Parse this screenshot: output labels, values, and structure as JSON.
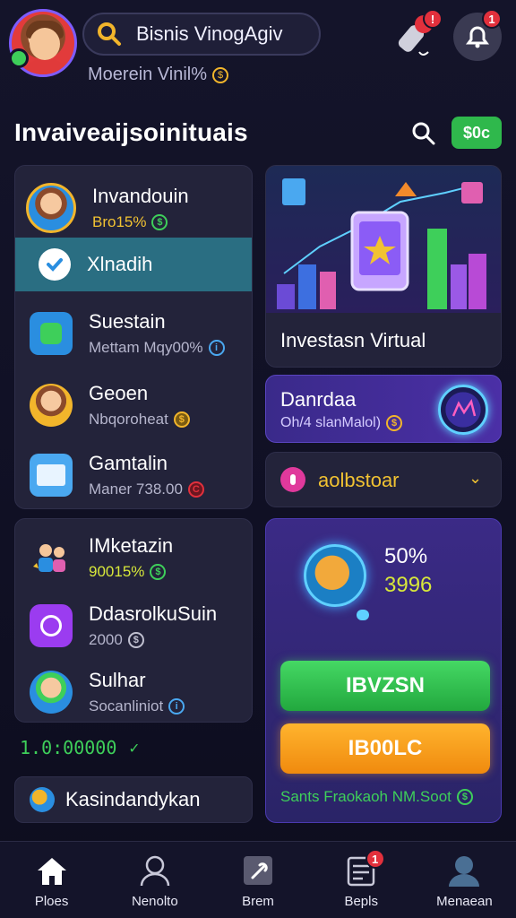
{
  "header": {
    "search_text": "Bisnis VinogAgiv",
    "subtitle": "Moerein Vinil%",
    "subtitle_coin": "$",
    "mic_badge": "!",
    "bell_badge": "1"
  },
  "section": {
    "title": "Invaiveaijsoinituais",
    "price_button": "$0c"
  },
  "list1": {
    "items": [
      {
        "title": "Invandouin",
        "sub": "Bro15%",
        "coin": "$"
      },
      {
        "title": "Xlnadih"
      },
      {
        "title": "Suestain",
        "sub": "Mettam Mqy00%",
        "coin": "i"
      },
      {
        "title": "Geoen",
        "sub": "Nbqoroheat",
        "coin": "$"
      },
      {
        "title": "Gamtalin",
        "sub": "Maner 738.00",
        "coin": "C"
      }
    ]
  },
  "hero": {
    "caption": "Investasn Virtual"
  },
  "promo": {
    "title": "Danrdaa",
    "sub": "Oh/4 slanMalol)",
    "coin": "$"
  },
  "dropdown": {
    "label": "aolbstoar",
    "chevron": "⌄"
  },
  "list2": {
    "items": [
      {
        "title": "IMketazin",
        "sub": "90015%",
        "coin": "$"
      },
      {
        "title": "DdasrolkuSuin",
        "sub": "2000",
        "coin": "$"
      },
      {
        "title": "Sulhar",
        "sub": "Socanliniot",
        "coin": "i"
      }
    ]
  },
  "balance": {
    "value": "1.0:00000",
    "check": "✓"
  },
  "bottom_row": {
    "label": "Kasindandykan"
  },
  "bigcard": {
    "percent": "50%",
    "value": "3996",
    "green_button": "IBVZSN",
    "orange_button": "IB00LC",
    "footer": "Sants Fraokaoh NM.Soot",
    "footer_coin": "$"
  },
  "nav": {
    "items": [
      {
        "label": "Ploes",
        "icon": "home-icon"
      },
      {
        "label": "Nenolto",
        "icon": "user-icon"
      },
      {
        "label": "Brem",
        "icon": "wrench-icon"
      },
      {
        "label": "Bepls",
        "icon": "document-icon",
        "badge": "1"
      },
      {
        "label": "Menaean",
        "icon": "profile-icon"
      }
    ]
  },
  "colors": {
    "background": "#14142a",
    "accent_green": "#3ecf5a",
    "accent_orange": "#f2a028",
    "accent_purple": "#4b2fa6",
    "selected_row": "#2a6e82",
    "badge_red": "#e2303c"
  }
}
